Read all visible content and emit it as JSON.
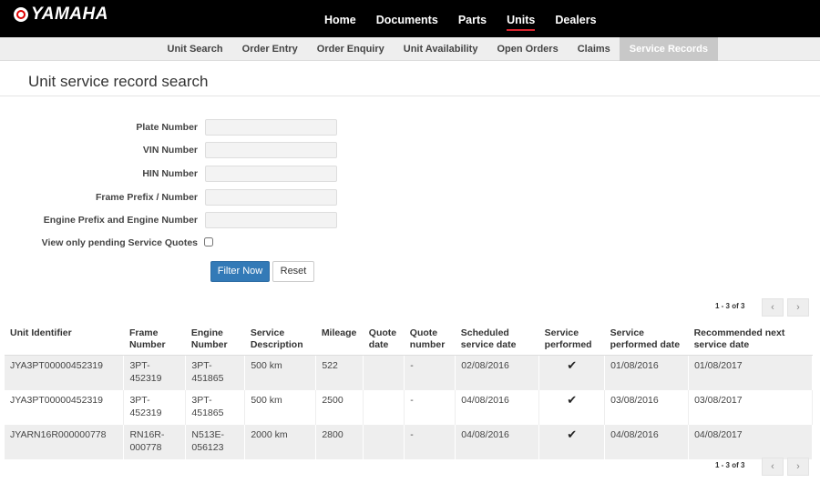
{
  "brand": {
    "name": "YAMAHA",
    "icon": "tuning-fork-logo-icon",
    "accent": "#d9232d"
  },
  "main_nav": [
    {
      "label": "Home",
      "active": false
    },
    {
      "label": "Documents",
      "active": false
    },
    {
      "label": "Parts",
      "active": false
    },
    {
      "label": "Units",
      "active": true
    },
    {
      "label": "Dealers",
      "active": false
    }
  ],
  "sub_nav": [
    {
      "label": "Unit Search",
      "active": false
    },
    {
      "label": "Order Entry",
      "active": false
    },
    {
      "label": "Order Enquiry",
      "active": false
    },
    {
      "label": "Unit Availability",
      "active": false
    },
    {
      "label": "Open Orders",
      "active": false
    },
    {
      "label": "Claims",
      "active": false
    },
    {
      "label": "Service Records",
      "active": true
    }
  ],
  "page": {
    "title": "Unit service record search"
  },
  "form": {
    "plate_number": {
      "label": "Plate Number",
      "value": ""
    },
    "vin_number": {
      "label": "VIN Number",
      "value": ""
    },
    "hin_number": {
      "label": "HIN Number",
      "value": ""
    },
    "frame_prefix": {
      "label": "Frame Prefix / Number",
      "value": ""
    },
    "engine_prefix": {
      "label": "Engine Prefix and Engine Number",
      "value": ""
    },
    "pending_quotes": {
      "label": "View only pending Service Quotes",
      "checked": false
    },
    "filter_label": "Filter Now",
    "reset_label": "Reset"
  },
  "pagination": {
    "summary": "1 - 3 of 3",
    "prev_icon": "chevron-left-icon",
    "next_icon": "chevron-right-icon",
    "prev_glyph": "‹",
    "next_glyph": "›"
  },
  "table": {
    "headers": {
      "unit_identifier": "Unit Identifier",
      "frame_number": "Frame Number",
      "engine_number": "Engine Number",
      "service_description": "Service Description",
      "mileage": "Mileage",
      "quote_date": "Quote date",
      "quote_number": "Quote number",
      "scheduled_service_date": "Scheduled service date",
      "service_performed": "Service performed",
      "service_performed_date": "Service performed date",
      "recommended_next_service_date": "Recommended next service date"
    },
    "rows": [
      {
        "unit_identifier": "JYA3PT00000452319",
        "frame_number": "3PT-452319",
        "engine_number": "3PT-451865",
        "service_description": "500 km",
        "mileage": "522",
        "quote_date": "",
        "quote_number": "-",
        "scheduled_service_date": "02/08/2016",
        "service_performed": "✔",
        "service_performed_date": "01/08/2016",
        "recommended_next_service_date": "01/08/2017"
      },
      {
        "unit_identifier": "JYA3PT00000452319",
        "frame_number": "3PT-452319",
        "engine_number": "3PT-451865",
        "service_description": "500 km",
        "mileage": "2500",
        "quote_date": "",
        "quote_number": "-",
        "scheduled_service_date": "04/08/2016",
        "service_performed": "✔",
        "service_performed_date": "03/08/2016",
        "recommended_next_service_date": "03/08/2017"
      },
      {
        "unit_identifier": "JYARN16R000000778",
        "frame_number": "RN16R-000778",
        "engine_number": "N513E-056123",
        "service_description": "2000 km",
        "mileage": "2800",
        "quote_date": "",
        "quote_number": "-",
        "scheduled_service_date": "04/08/2016",
        "service_performed": "✔",
        "service_performed_date": "04/08/2016",
        "recommended_next_service_date": "04/08/2017"
      }
    ]
  }
}
